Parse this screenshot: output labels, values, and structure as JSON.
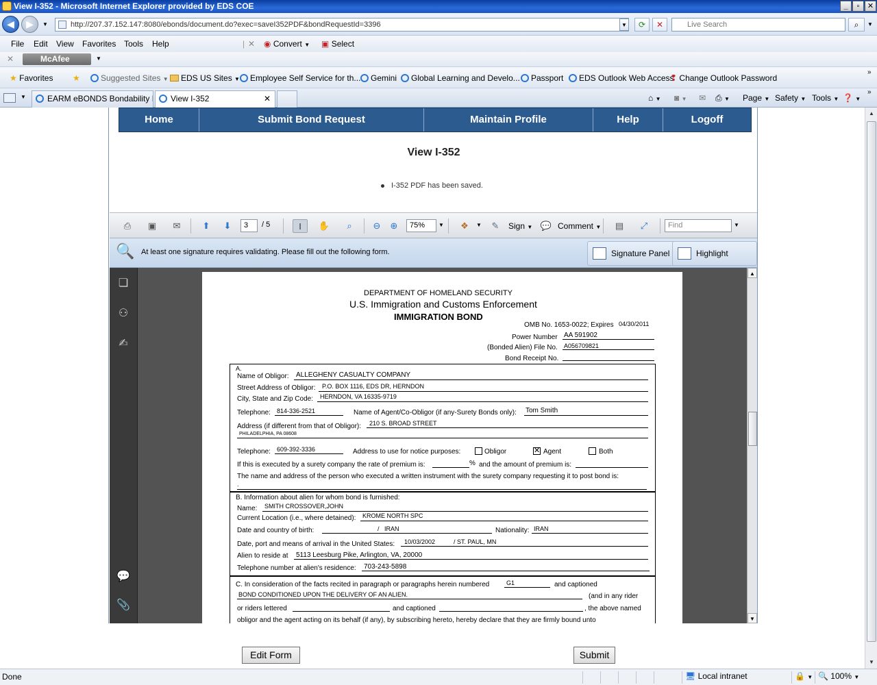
{
  "window": {
    "title": "View I-352 - Microsoft Internet Explorer provided by EDS COE"
  },
  "address": {
    "url": "http://207.37.152.147:8080/ebonds/document.do?exec=saveI352PDF&bondRequestId=3396",
    "search_placeholder": "Live Search"
  },
  "menu": [
    "File",
    "Edit",
    "View",
    "Favorites",
    "Tools",
    "Help"
  ],
  "toolbar": {
    "convert": "Convert",
    "select": "Select",
    "mcafee": "McAfee"
  },
  "favorites": {
    "label": "Favorites",
    "items": [
      "Suggested Sites",
      "EDS US Sites",
      "Employee Self Service for th...",
      "Gemini",
      "Global Learning and Develo...",
      "Passport",
      "EDS Outlook Web Access",
      "Change Outlook Password"
    ]
  },
  "tabs": [
    {
      "label": "EARM eBONDS Bondability R..."
    },
    {
      "label": "View I-352"
    }
  ],
  "commandbar": {
    "page": "Page",
    "safety": "Safety",
    "tools": "Tools"
  },
  "nav": [
    "Home",
    "Submit Bond Request",
    "Maintain Profile",
    "Help",
    "Logoff"
  ],
  "page": {
    "title": "View I-352",
    "message": "I-352 PDF has been saved."
  },
  "reader": {
    "current_page": "3",
    "total_pages": "/ 5",
    "zoom": "75%",
    "sign_label": "Sign",
    "comment_label": "Comment",
    "find_placeholder": "Find",
    "signature_message": "At least one signature requires validating.  Please fill out the following form.",
    "signature_panel": "Signature Panel",
    "highlight_fields": "Highlight Fields"
  },
  "form": {
    "dept": "DEPARTMENT OF HOMELAND SECURITY",
    "agency": "U.S. Immigration and Customs Enforcement",
    "doc_title": "IMMIGRATION BOND",
    "omb": "OMB No. 1653-0022; Expires",
    "omb_date": "04/30/2011",
    "power_number_label": "Power Number",
    "power_number": "AA 591902",
    "file_no_label": "(Bonded Alien) File No.",
    "file_no": "A056709821",
    "receipt_label": "Bond Receipt No.",
    "section_a": "A.",
    "obligor_label": "Name of Obligor:",
    "obligor": "ALLEGHENY CASUALTY COMPANY",
    "street_label": "Street Address of Obligor:",
    "street": "P.O. BOX 1116, EDS DR, HERNDON",
    "city_label": "City, State and Zip Code:",
    "city": "HERNDON, VA 16335-9719",
    "phone_label": "Telephone:",
    "phone": "814-336-2521",
    "agent_label": "Name of Agent/Co-Obligor (if any-Surety Bonds only):",
    "agent": "Tom Smith",
    "agent_addr_label": "Address (if different from that of Obligor):",
    "agent_addr": "210 S. BROAD STREET",
    "agent_city": "PHILADELPHIA, PA 08608",
    "agent_phone_label": "Telephone:",
    "agent_phone": "609-392-3336",
    "notice_label": "Address to use for notice purposes:",
    "opt_obligor": "Obligor",
    "opt_agent": "Agent",
    "opt_both": "Both",
    "check_mark": "✕",
    "premium_label": "If this is executed by a surety company the rate of premium is:",
    "pct": "%",
    "amount_label": "and the amount of premium is:",
    "executed_label": "The name and address of the person who executed a written instrument with the surety company requesting it to post bond is:",
    "executed_value": ".",
    "section_b": "B.  Information about alien for whom bond is furnished:",
    "name_label": "Name:",
    "name": "SMITH CROSSOVER,JOHN",
    "location_label": "Current Location (i.e., where detained):",
    "location": "KROME NORTH SPC",
    "birth_label": "Date and country of birth:",
    "birth_sep": "/",
    "birth_country": "IRAN",
    "nationality_label": "Nationality:",
    "nationality": "IRAN",
    "arrival_label": "Date, port and means of arrival in the United States:",
    "arrival_date": "10/03/2002",
    "arrival_port": "/  ST. PAUL, MN",
    "reside_label": "Alien to reside at",
    "reside": "5113 Leesburg Pike, Arlington, VA, 20000",
    "res_phone_label": "Telephone number at alien's residence:",
    "res_phone": "703-243-5898",
    "section_c": "C.  In consideration of the facts recited in paragraph or paragraphs herein numbered",
    "para_no": "G1",
    "captioned": "and captioned",
    "condition": "BOND CONDITIONED UPON THE DELIVERY OF AN ALIEN.",
    "rider_label": "(and in any rider",
    "riders_lettered": "or riders lettered",
    "captioned2": "and captioned",
    "above_named": ", the above named",
    "last_line": "obligor and the agent acting on its behalf (if any), by subscribing hereto, hereby declare that they are firmly bound unto"
  },
  "buttons": {
    "edit": "Edit Form",
    "submit": "Submit"
  },
  "status": {
    "text": "Done",
    "zone": "Local intranet",
    "zoom": "100%"
  }
}
